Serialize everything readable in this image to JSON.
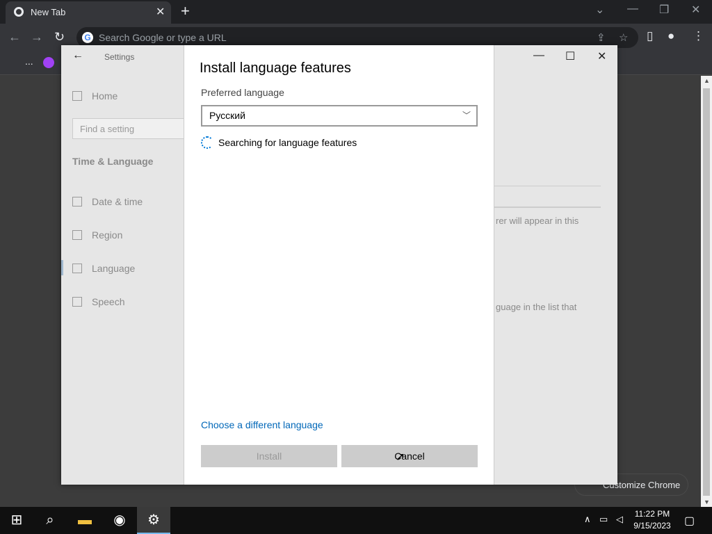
{
  "browser": {
    "tab_title": "New Tab",
    "omnibox_placeholder": "Search Google or type a URL",
    "bookmark_overflow": "...",
    "customize_label": "Customize Chrome"
  },
  "settings": {
    "title": "Settings",
    "sidebar": {
      "home": "Home",
      "search_placeholder": "Find a setting",
      "section": "Time & Language",
      "items": [
        {
          "label": "Date & time",
          "icon": "calendar-clock-icon"
        },
        {
          "label": "Region",
          "icon": "globe-icon"
        },
        {
          "label": "Language",
          "icon": "language-icon"
        },
        {
          "label": "Speech",
          "icon": "microphone-icon"
        }
      ]
    },
    "right_panel": {
      "text1": "rer will appear in this",
      "text2": "guage in the list that"
    }
  },
  "dialog": {
    "title": "Install language features",
    "preferred_label": "Preferred language",
    "selected_language": "Русский",
    "status": "Searching for language features",
    "link": "Choose a different language",
    "install_label": "Install",
    "cancel_label": "Cancel"
  },
  "taskbar": {
    "time": "11:22 PM",
    "date": "9/15/2023"
  }
}
